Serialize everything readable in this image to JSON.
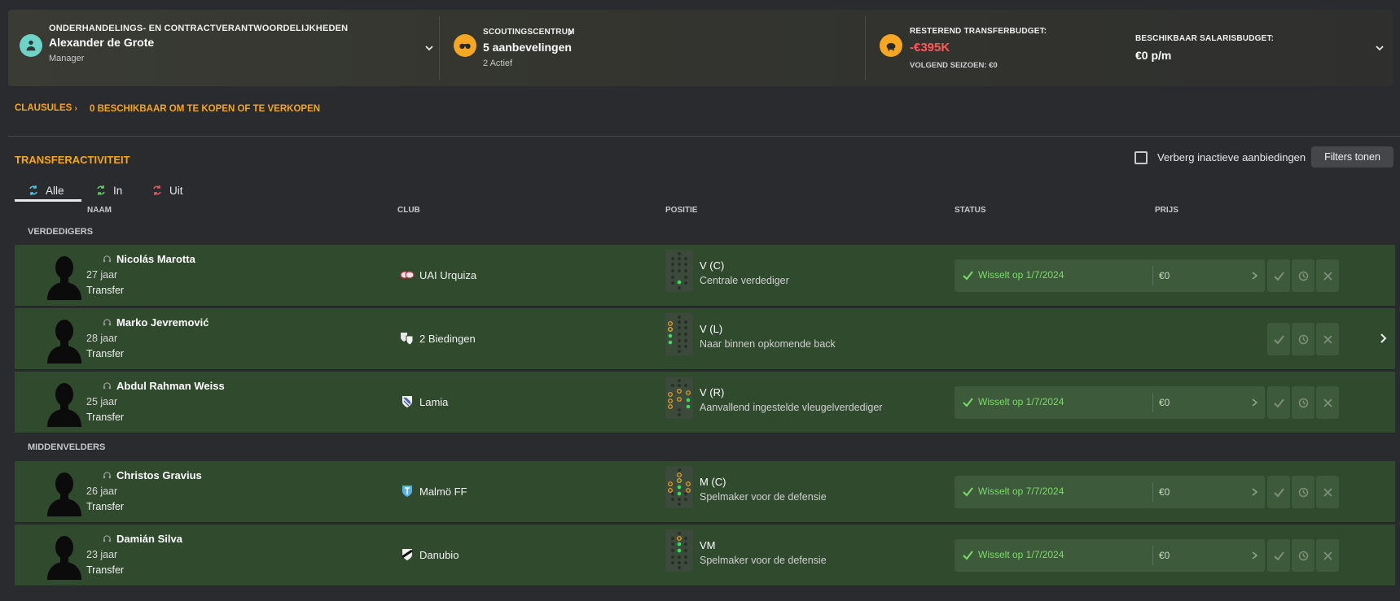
{
  "topbar": {
    "manager": {
      "label": "ONDERHANDELINGS- EN CONTRACTVERANTWOORDELIJKHEDEN",
      "name": "Alexander de Grote",
      "role": "Manager"
    },
    "scouting": {
      "label": "SCOUTINGSCENTRUM",
      "value": "5 aanbevelingen",
      "sub": "2 Actief"
    },
    "transfer_budget": {
      "label": "RESTEREND TRANSFERBUDGET:",
      "value": "-€395K",
      "sub": "VOLGEND SEIZOEN: €0"
    },
    "wage_budget": {
      "label": "BESCHIKBAAR SALARISBUDGET:",
      "value": "€0 p/m"
    }
  },
  "clauses": {
    "label": "CLAUSULES",
    "value": "0 BESCHIKBAAR OM TE KOPEN OF TE VERKOPEN"
  },
  "activity": {
    "title": "TRANSFERACTIVITEIT",
    "hide_inactive_label": "Verberg inactieve aanbiedingen",
    "filters_label": "Filters tonen",
    "tabs": [
      {
        "label": "Alle"
      },
      {
        "label": "In"
      },
      {
        "label": "Uit"
      }
    ],
    "columns": {
      "name": "NAAM",
      "club": "CLUB",
      "position": "POSITIE",
      "status": "STATUS",
      "price": "PRIJS"
    },
    "groups": [
      {
        "title": "VERDEDIGERS",
        "rows": [
          {
            "name": "Nicolás Marotta",
            "age": "27 jaar",
            "type": "Transfer",
            "club": "UAI Urquiza",
            "position": "V (C)",
            "role": "Centrale verdediger",
            "status": "Wisselt op 1/7/2024",
            "price": "€0"
          },
          {
            "name": "Marko Jevremović",
            "age": "28 jaar",
            "type": "Transfer",
            "club": "2 Biedingen",
            "position": "V (L)",
            "role": "Naar binnen opkomende back",
            "status": "",
            "price": ""
          },
          {
            "name": "Abdul Rahman Weiss",
            "age": "25 jaar",
            "type": "Transfer",
            "club": "Lamia",
            "position": "V (R)",
            "role": "Aanvallend ingestelde vleugelverdediger",
            "status": "Wisselt op 1/7/2024",
            "price": "€0"
          }
        ]
      },
      {
        "title": "MIDDENVELDERS",
        "rows": [
          {
            "name": "Christos Gravius",
            "age": "26 jaar",
            "type": "Transfer",
            "club": "Malmö FF",
            "position": "M (C)",
            "role": "Spelmaker voor de defensie",
            "status": "Wisselt op 7/7/2024",
            "price": "€0"
          },
          {
            "name": "Damián Silva",
            "age": "23 jaar",
            "type": "Transfer",
            "club": "Danubio",
            "position": "VM",
            "role": "Spelmaker voor de defensie",
            "status": "Wisselt op 1/7/2024",
            "price": "€0"
          }
        ]
      }
    ]
  },
  "colors": {
    "accent": "#f5a623",
    "negative": "#ff5a5a",
    "row_bg": "#2f4a2d",
    "status_green": "#7cdc6a"
  }
}
